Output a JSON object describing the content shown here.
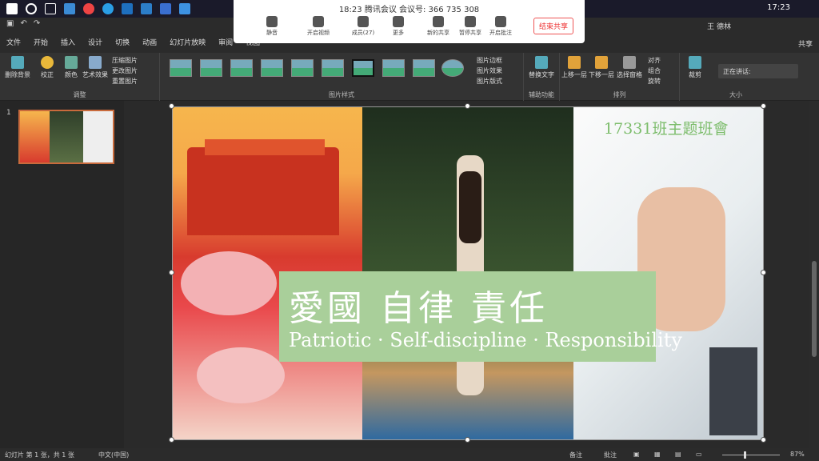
{
  "taskbar": {
    "time": "17:23"
  },
  "meeting": {
    "time": "18:23",
    "title": "腾讯会议 会议号: 366 735 308",
    "buttons": [
      "静音",
      "开启视频",
      "成员(27)",
      "更多",
      "新的共享",
      "暂停共享",
      "开启批注"
    ],
    "end": "结束共享"
  },
  "quickaccess": {
    "user": "王 德林",
    "share": "共享"
  },
  "menu": [
    "文件",
    "开始",
    "插入",
    "设计",
    "切换",
    "动画",
    "幻灯片放映",
    "审阅",
    "视图"
  ],
  "ribbon": {
    "adjust": {
      "label": "调整",
      "buttons": [
        "删除背景",
        "校正",
        "颜色",
        "艺术效果"
      ],
      "small": [
        "压缩图片",
        "更改图片",
        "重置图片"
      ]
    },
    "styles": {
      "label": "图片样式",
      "small": [
        "图片边框",
        "图片效果",
        "图片版式"
      ]
    },
    "aux": {
      "label": "辅助功能",
      "button": "替换文字"
    },
    "arrange": {
      "label": "排列",
      "buttons": [
        "上移一层",
        "下移一层",
        "选择窗格"
      ],
      "small": [
        "对齐",
        "组合",
        "旋转"
      ]
    },
    "size": {
      "label": "大小",
      "button": "裁剪"
    }
  },
  "speaking": "正在讲话:",
  "slidepane": {
    "number": "1"
  },
  "slide": {
    "title": "17331班主题班會",
    "cn": "愛國 自律 責任",
    "en": "Patriotic · Self-discipline · Responsibility"
  },
  "status": {
    "slide": "幻灯片 第 1 张，共 1 张",
    "lang": "中文(中国)",
    "notes": "备注",
    "comments": "批注",
    "zoom": "87%"
  }
}
